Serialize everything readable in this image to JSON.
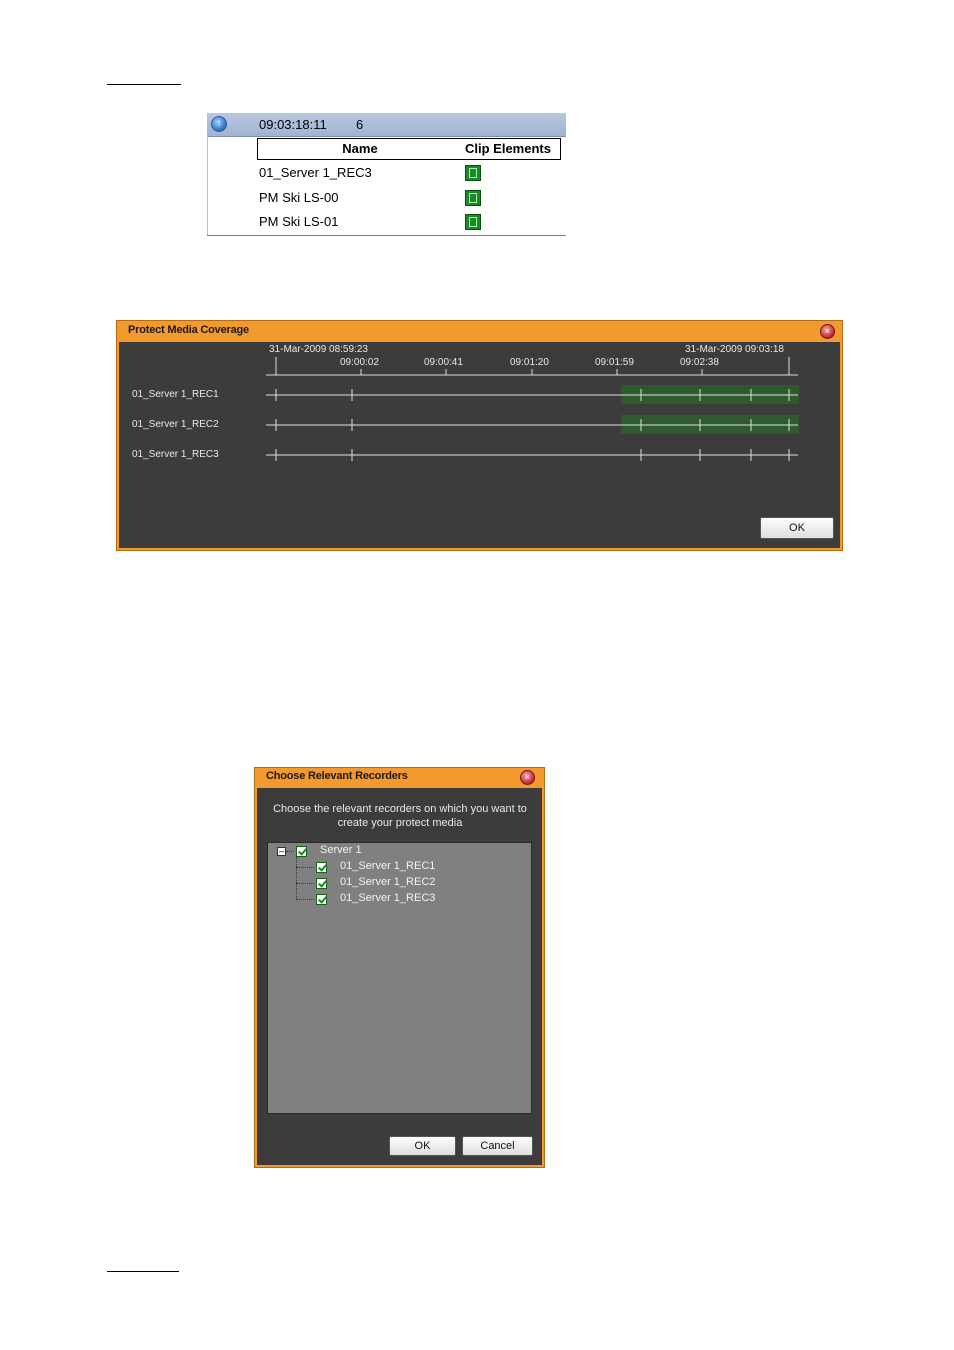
{
  "clip_table": {
    "timecode": "09:03:18:11",
    "count": "6",
    "columns": [
      "Name",
      "Clip Elements"
    ],
    "rows": [
      {
        "name": "01_Server 1_REC3",
        "icon": "clip-element-icon"
      },
      {
        "name": "PM Ski LS-00",
        "icon": "clip-element-icon"
      },
      {
        "name": "PM Ski LS-01",
        "icon": "clip-element-icon"
      }
    ]
  },
  "coverage_dialog": {
    "title": "Protect Media Coverage",
    "start_time": "31-Mar-2009 08:59:23",
    "end_time": "31-Mar-2009 09:03:18",
    "ticks": [
      "09:00:02",
      "09:00:41",
      "09:01:20",
      "09:01:59",
      "09:02:38"
    ],
    "recorders": [
      "01_Server 1_REC1",
      "01_Server 1_REC2",
      "01_Server 1_REC3"
    ],
    "ok_label": "OK",
    "colors": {
      "background": "#3c3c3c",
      "frame": "#f39a2e",
      "coverage": "#2f5a2f"
    }
  },
  "recorders_dialog": {
    "title": "Choose Relevant Recorders",
    "instruction_line1": "Choose the relevant recorders on which you want to",
    "instruction_line2": "create your protect media",
    "server": {
      "label": "Server 1",
      "checked": true
    },
    "recorders": [
      {
        "label": "01_Server 1_REC1",
        "checked": true
      },
      {
        "label": "01_Server 1_REC2",
        "checked": true
      },
      {
        "label": "01_Server 1_REC3",
        "checked": true
      }
    ],
    "ok_label": "OK",
    "cancel_label": "Cancel"
  }
}
